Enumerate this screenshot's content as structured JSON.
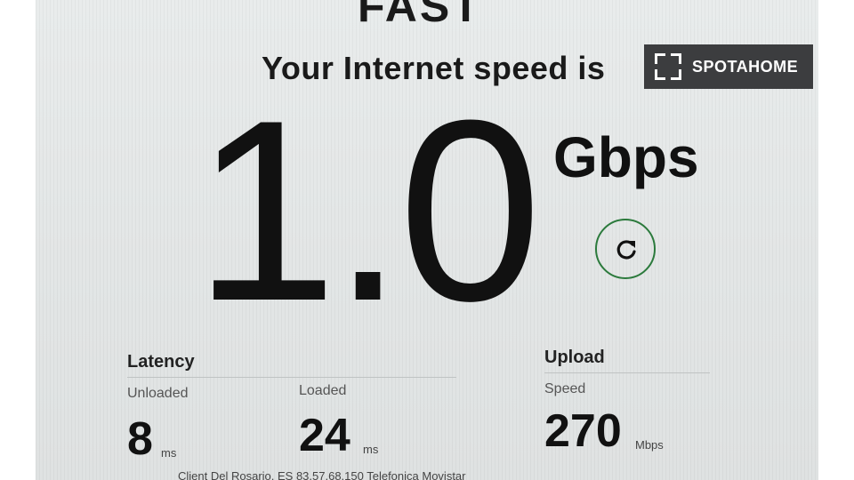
{
  "brand": "FAST",
  "headline": "Your Internet speed is",
  "speed": {
    "value": "1.0",
    "units": "Gbps"
  },
  "latency": {
    "label": "Latency",
    "unloaded": {
      "label": "Unloaded",
      "value": "8",
      "unit": "ms"
    },
    "loaded": {
      "label": "Loaded",
      "value": "24",
      "unit": "ms"
    }
  },
  "upload": {
    "label": "Upload",
    "sub_label": "Speed",
    "value": "270",
    "unit": "Mbps"
  },
  "footer": "Client  Del Rosario, ES   83.57.68.150   Telefonica   Movistar",
  "watermark": {
    "text": "SPOTAHOME"
  },
  "icons": {
    "refresh": "refresh-icon",
    "watermark_logo": "spotahome-logo-icon"
  },
  "colors": {
    "refresh_ring": "#2b7a3c",
    "watermark_bg": "#3c3d3f"
  }
}
